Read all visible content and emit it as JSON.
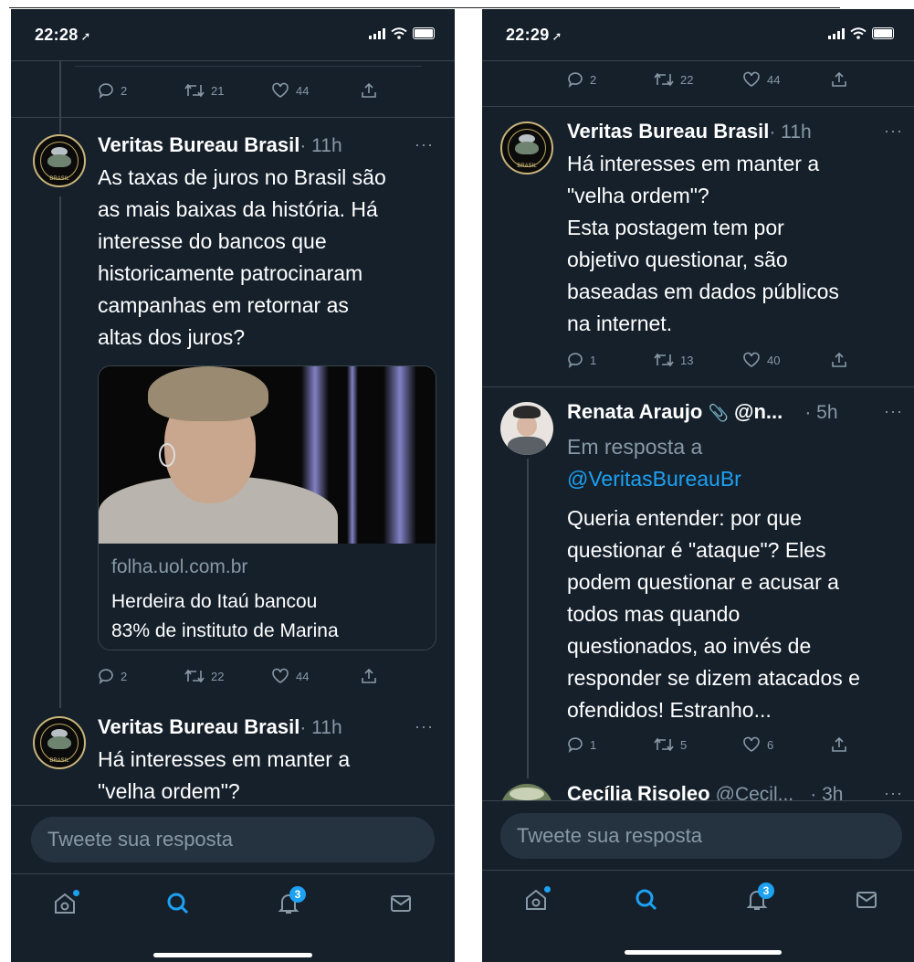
{
  "left": {
    "status": {
      "time": "22:28"
    },
    "top_actions": {
      "reply": "2",
      "retweet": "21",
      "like": "44"
    },
    "tweet1": {
      "author": "Veritas Bureau Brasil",
      "time": "· 11h",
      "more": "···",
      "text": "As taxas de juros no Brasil são\nas mais baixas da história. Há\ninteresse do bancos que\nhistoricamente patrocinaram\ncampanhas em retornar as\naltas dos juros?",
      "card": {
        "domain": "folha.uol.com.br",
        "title": "Herdeira do Itaú bancou\n83% de instituto de Marina"
      },
      "actions": {
        "reply": "2",
        "retweet": "22",
        "like": "44"
      }
    },
    "tweet2": {
      "author": "Veritas Bureau Brasil",
      "time": "· 11h",
      "more": "···",
      "text": "Há interesses em manter a\n\"velha ordem\"?"
    },
    "reply_placeholder": "Tweete sua resposta",
    "tabbar": {
      "notifications_badge": "3"
    }
  },
  "right": {
    "status": {
      "time": "22:29"
    },
    "top_actions": {
      "reply": "2",
      "retweet": "22",
      "like": "44"
    },
    "tweet1": {
      "author": "Veritas Bureau Brasil",
      "time": "· 11h",
      "more": "···",
      "text": "Há interesses em manter a\n\"velha ordem\"?\nEsta postagem tem por\nobjetivo questionar, são\nbaseadas em dados públicos\nna internet.",
      "actions": {
        "reply": "1",
        "retweet": "13",
        "like": "40"
      }
    },
    "tweet2": {
      "author": "Renata Araujo",
      "emoji": "📎",
      "handle": "@n...",
      "time": "· 5h",
      "more": "···",
      "in_reply_label": "Em resposta a",
      "in_reply_handle": "@VeritasBureauBr",
      "text": "Queria entender: por que\nquestionar é \"ataque\"? Eles\npodem questionar e acusar a\ntodos mas quando\nquestionados, ao invés de\nresponder se dizem atacados e\nofendidos! Estranho...",
      "actions": {
        "reply": "1",
        "retweet": "5",
        "like": "6"
      }
    },
    "tweet3": {
      "author": "Cecília Risoleo",
      "handle": "@Cecil...",
      "time": "· 3h",
      "more": "···"
    },
    "reply_placeholder": "Tweete sua resposta",
    "tabbar": {
      "notifications_badge": "3"
    }
  },
  "colors": {
    "background": "#15202b",
    "accent": "#1da1f2",
    "muted": "#8899a6",
    "divider": "#38444d"
  },
  "icons": [
    "location-arrow-icon",
    "signal-icon",
    "wifi-icon",
    "battery-icon",
    "reply-icon",
    "retweet-icon",
    "like-icon",
    "share-icon",
    "home-icon",
    "search-icon",
    "notifications-icon",
    "messages-icon"
  ]
}
